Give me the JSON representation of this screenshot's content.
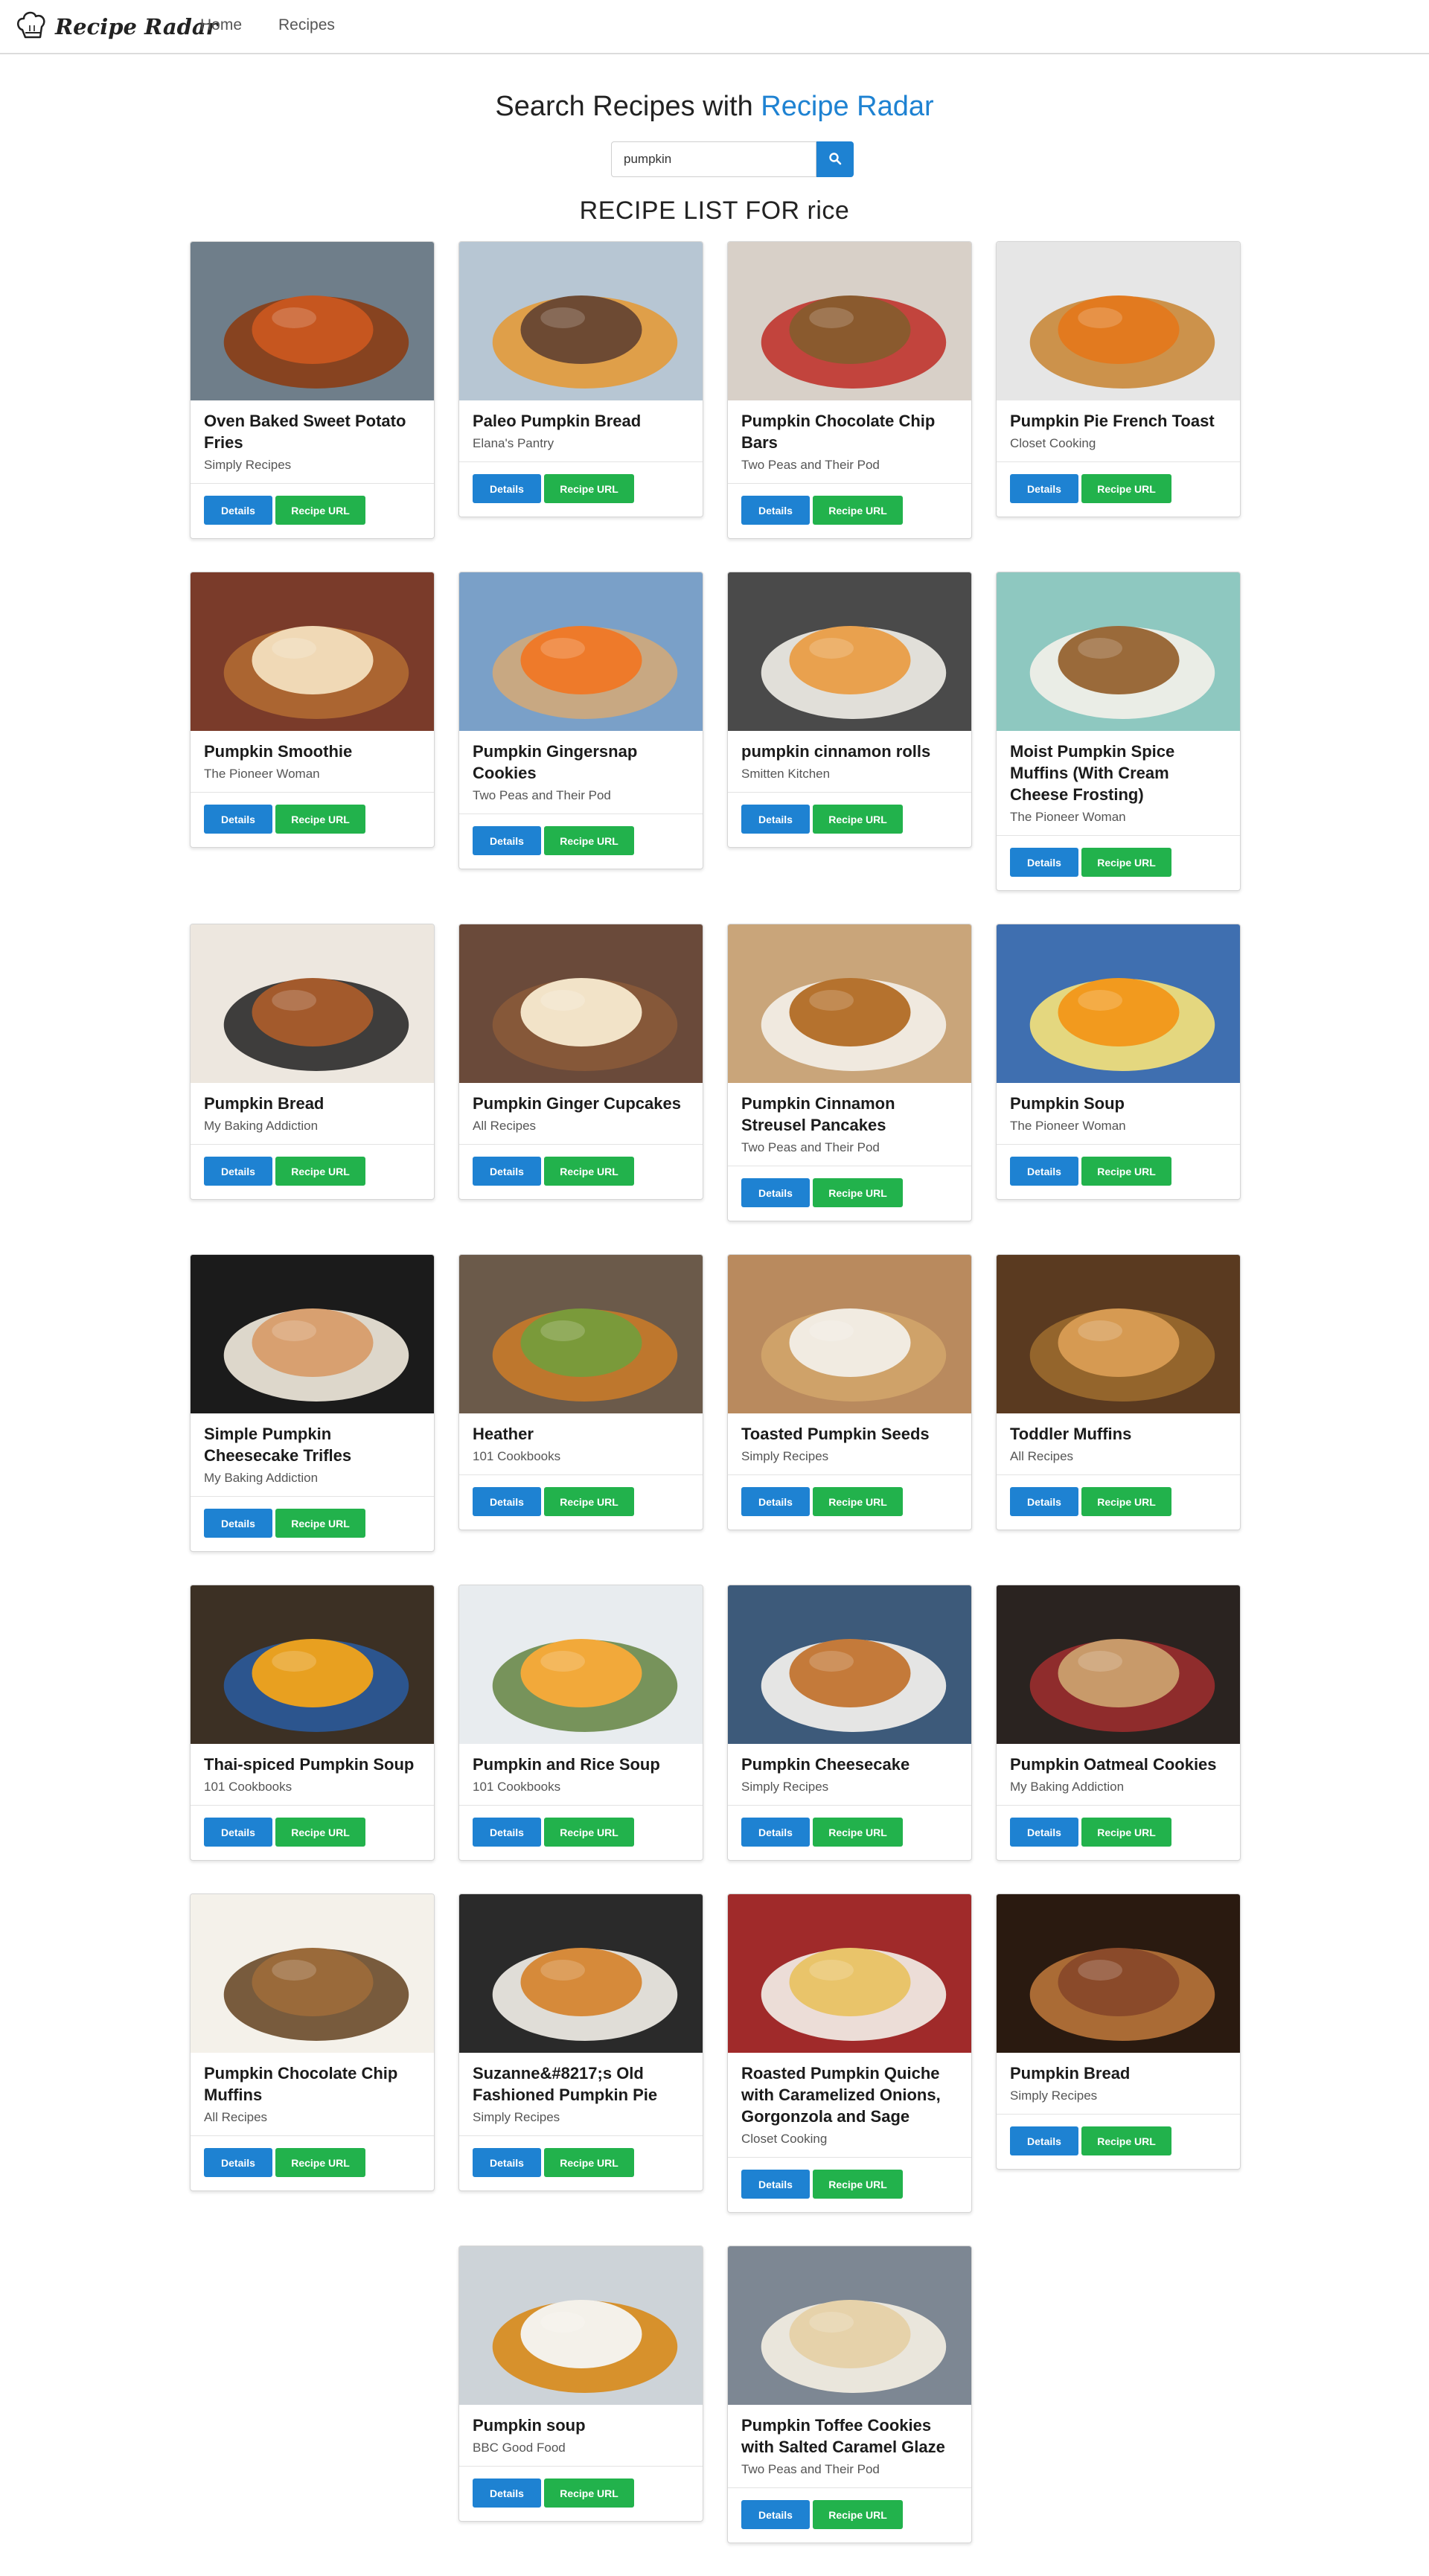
{
  "brand": {
    "name": "Recipe Radar",
    "logo_icon": "chef-hat-icon"
  },
  "nav": {
    "home": "Home",
    "recipes": "Recipes"
  },
  "search": {
    "heading_prefix": "Search Recipes with",
    "heading_accent": "Recipe Radar",
    "value": "pumpkin",
    "button_icon": "search-icon"
  },
  "list_heading": "RECIPE LIST FOR rice",
  "buttons": {
    "details": "Details",
    "recipe_url": "Recipe URL"
  },
  "colors": {
    "accent": "#1e82d2",
    "details_button": "#1e82d2",
    "url_button": "#22b24c"
  },
  "recipes": [
    {
      "title": "Oven Baked Sweet Potato Fries",
      "source": "Simply Recipes",
      "img": "sweet-potato-fries-photo"
    },
    {
      "title": "Paleo Pumpkin Bread",
      "source": "Elana's Pantry",
      "img": "pumpkin-bread-pan-photo"
    },
    {
      "title": "Pumpkin Chocolate Chip Bars",
      "source": "Two Peas and Their Pod",
      "img": "chocolate-chip-bars-photo"
    },
    {
      "title": "Pumpkin Pie French Toast",
      "source": "Closet Cooking",
      "img": "french-toast-photo"
    },
    {
      "title": "Pumpkin Smoothie",
      "source": "The Pioneer Woman",
      "img": "smoothie-photo"
    },
    {
      "title": "Pumpkin Gingersnap Cookies",
      "source": "Two Peas and Their Pod",
      "img": "gingersnap-cookies-photo"
    },
    {
      "title": "pumpkin cinnamon rolls",
      "source": "Smitten Kitchen",
      "img": "cinnamon-rolls-photo"
    },
    {
      "title": "Moist Pumpkin Spice Muffins (With Cream Cheese Frosting)",
      "source": "The Pioneer Woman",
      "img": "spice-muffins-photo"
    },
    {
      "title": "Pumpkin Bread",
      "source": "My Baking Addiction",
      "img": "pumpkin-bread-slices-photo"
    },
    {
      "title": "Pumpkin Ginger Cupcakes",
      "source": "All Recipes",
      "img": "ginger-cupcake-photo"
    },
    {
      "title": "Pumpkin Cinnamon Streusel Pancakes",
      "source": "Two Peas and Their Pod",
      "img": "pancakes-photo"
    },
    {
      "title": "Pumpkin Soup",
      "source": "The Pioneer Woman",
      "img": "pumpkin-soup-bowl-photo"
    },
    {
      "title": "Simple Pumpkin Cheesecake Trifles",
      "source": "My Baking Addiction",
      "img": "cheesecake-trifle-photo"
    },
    {
      "title": "Heather",
      "source": "101 Cookbooks",
      "img": "grain-salad-photo"
    },
    {
      "title": "Toasted Pumpkin Seeds",
      "source": "Simply Recipes",
      "img": "pumpkin-seeds-photo"
    },
    {
      "title": "Toddler Muffins",
      "source": "All Recipes",
      "img": "toddler-muffins-photo"
    },
    {
      "title": "Thai-spiced Pumpkin Soup",
      "source": "101 Cookbooks",
      "img": "thai-soup-photo"
    },
    {
      "title": "Pumpkin and Rice Soup",
      "source": "101 Cookbooks",
      "img": "rice-soup-photo"
    },
    {
      "title": "Pumpkin Cheesecake",
      "source": "Simply Recipes",
      "img": "cheesecake-slice-photo"
    },
    {
      "title": "Pumpkin Oatmeal Cookies",
      "source": "My Baking Addiction",
      "img": "oatmeal-cookies-photo"
    },
    {
      "title": "Pumpkin Chocolate Chip Muffins",
      "source": "All Recipes",
      "img": "chip-muffins-photo"
    },
    {
      "title": "Suzanne&#8217;s Old Fashioned Pumpkin Pie",
      "source": "Simply Recipes",
      "img": "pumpkin-pie-slice-photo"
    },
    {
      "title": "Roasted Pumpkin Quiche with Caramelized Onions, Gorgonzola and Sage",
      "source": "Closet Cooking",
      "img": "quiche-photo"
    },
    {
      "title": "Pumpkin Bread",
      "source": "Simply Recipes",
      "img": "pumpkin-loaf-photo"
    },
    {
      "title": "Pumpkin soup",
      "source": "BBC Good Food",
      "img": "pumpkin-soup-plate-photo"
    },
    {
      "title": "Pumpkin Toffee Cookies with Salted Caramel Glaze",
      "source": "Two Peas and Their Pod",
      "img": "toffee-cookies-photo"
    }
  ]
}
